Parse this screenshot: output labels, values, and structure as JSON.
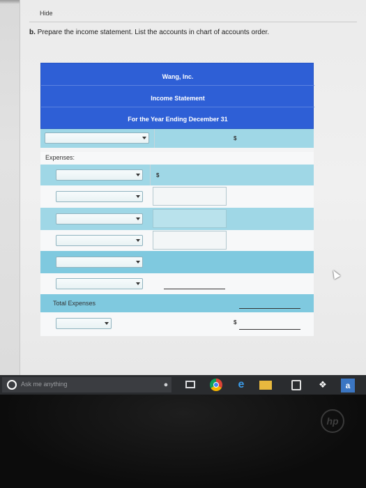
{
  "page": {
    "hide_link": "Hide",
    "instruction_prefix": "b.",
    "instruction_text": "Prepare the income statement. List the accounts in chart of accounts order."
  },
  "statement": {
    "company": "Wang, Inc.",
    "title": "Income Statement",
    "period": "For the Year Ending December 31",
    "dollar_sign": "$",
    "expenses_label": "Expenses:",
    "total_expenses_label": "Total Expenses"
  },
  "taskbar": {
    "search_placeholder": "Ask me anything",
    "edge_glyph": "e",
    "amazon_glyph": "a",
    "dropbox_glyph": "❖"
  },
  "bezel": {
    "brand": "hp"
  }
}
